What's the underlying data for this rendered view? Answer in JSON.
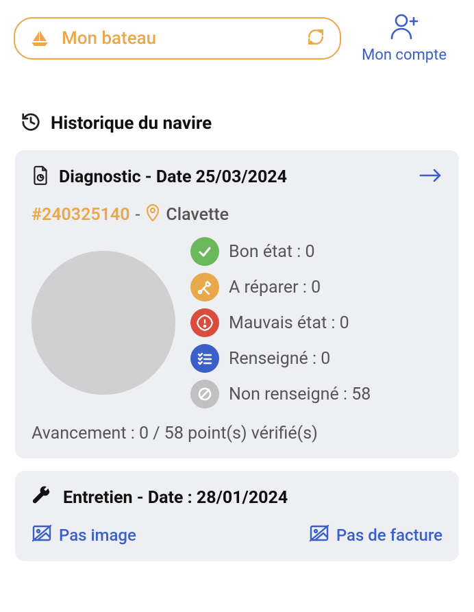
{
  "header": {
    "boat_label": "Mon bateau",
    "account_label": "Mon compte"
  },
  "section": {
    "title": "Historique du navire"
  },
  "diagnostic": {
    "title": "Diagnostic - Date 25/03/2024",
    "id": "#240325140",
    "separator": "-",
    "location": "Clavette",
    "stats": {
      "good": "Bon état : 0",
      "repair": "A réparer : 0",
      "bad": "Mauvais état : 0",
      "filled": "Renseigné : 0",
      "unfilled": "Non renseigné : 58"
    },
    "progress": "Avancement : 0 / 58 point(s) vérifié(s)"
  },
  "maintenance": {
    "title": "Entretien - Date : 28/01/2024",
    "no_image": "Pas image",
    "no_bill": "Pas de facture"
  }
}
